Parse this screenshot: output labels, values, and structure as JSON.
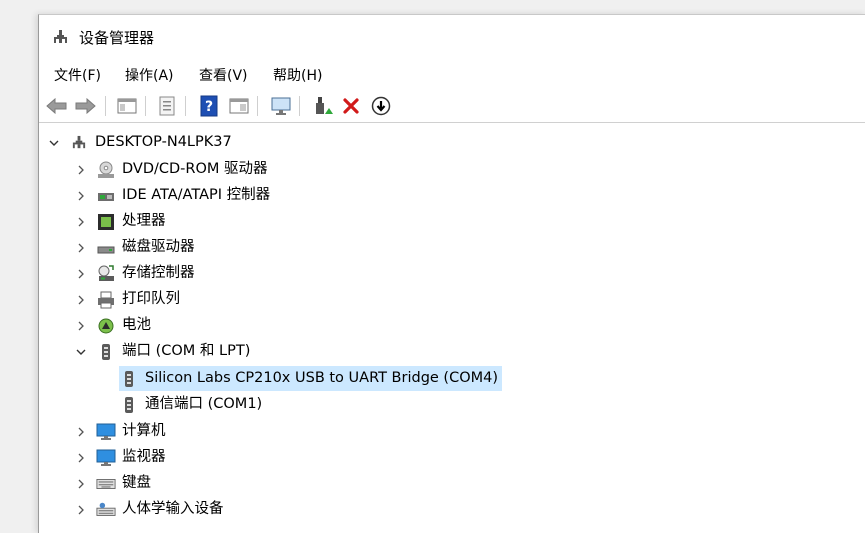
{
  "window": {
    "title": "设备管理器"
  },
  "menu": {
    "file": "文件(F)",
    "action": "操作(A)",
    "view": "查看(V)",
    "help": "帮助(H)"
  },
  "tree": {
    "root": "DESKTOP-N4LPK37",
    "items": [
      {
        "label": "DVD/CD-ROM 驱动器",
        "icon": "dvd-drive-icon"
      },
      {
        "label": "IDE ATA/ATAPI 控制器",
        "icon": "ide-controller-icon"
      },
      {
        "label": "处理器",
        "icon": "processor-icon"
      },
      {
        "label": "磁盘驱动器",
        "icon": "disk-drive-icon"
      },
      {
        "label": "存储控制器",
        "icon": "storage-controller-icon"
      },
      {
        "label": "打印队列",
        "icon": "printer-icon"
      },
      {
        "label": "电池",
        "icon": "battery-icon"
      },
      {
        "label": "端口 (COM 和 LPT)",
        "icon": "port-icon",
        "expanded": true
      },
      {
        "label": "计算机",
        "icon": "computer-icon"
      },
      {
        "label": "监视器",
        "icon": "monitor-icon"
      },
      {
        "label": "键盘",
        "icon": "keyboard-icon"
      },
      {
        "label": "人体学输入设备",
        "icon": "hid-icon"
      }
    ],
    "ports": [
      {
        "label": "Silicon Labs CP210x USB to UART Bridge (COM4)",
        "selected": true
      },
      {
        "label": "通信端口 (COM1)",
        "selected": false
      }
    ]
  },
  "colors": {
    "selection": "#cce8ff",
    "help_icon": "#1e4fb3",
    "delete_icon": "#d11a1a"
  }
}
